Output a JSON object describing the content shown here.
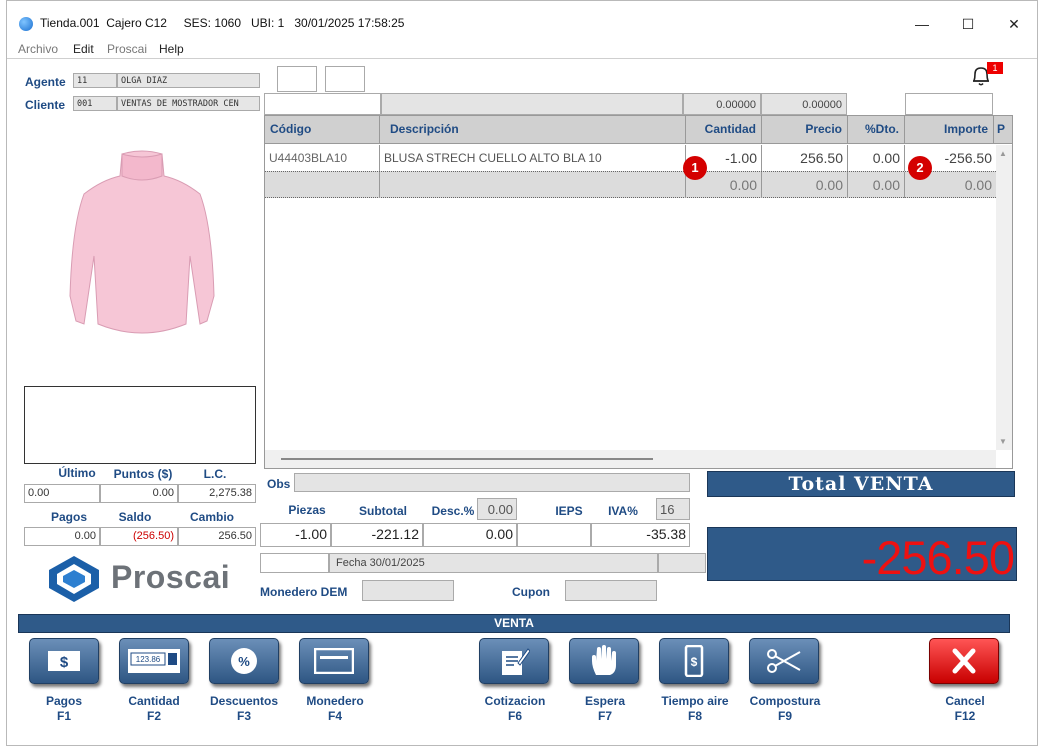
{
  "window": {
    "title": "Tienda.001  Cajero C12     SES: 1060   UBI: 1   30/01/2025 17:58:25",
    "minimize": "—",
    "maximize": "☐",
    "close": "✕"
  },
  "menu": [
    "Archivo",
    "Edit",
    "Proscai",
    "Help"
  ],
  "agente": {
    "label": "Agente",
    "code": "11",
    "name": "OLGA DIAZ"
  },
  "cliente": {
    "label": "Cliente",
    "code": "001",
    "name": "VENTAS DE MOSTRADOR CEN"
  },
  "notification": {
    "count": "1"
  },
  "header_values": {
    "v1": "0.00000",
    "v2": "0.00000"
  },
  "grid": {
    "columns": [
      "Código",
      "Descripción",
      "Cantidad",
      "Precio",
      "%Dto.",
      "Importe",
      "P"
    ],
    "rows": [
      [
        "U44403BLA10",
        "BLUSA STRECH CUELLO ALTO BLA 10",
        "-1.00",
        "256.50",
        "0.00",
        "-256.50"
      ],
      [
        "",
        "",
        "0.00",
        "0.00",
        "0.00",
        "0.00"
      ]
    ],
    "badges": [
      "1",
      "2"
    ]
  },
  "points": {
    "labels": [
      "Último",
      "Puntos ($)",
      "L.C."
    ],
    "values": [
      "0.00",
      "0.00",
      "2,275.38"
    ]
  },
  "payments": {
    "labels": [
      "Pagos",
      "Saldo",
      "Cambio"
    ],
    "values": [
      "0.00",
      "(256.50)",
      "256.50"
    ],
    "saldo_color": "#cc0000"
  },
  "brand": {
    "name": "Proscai"
  },
  "obs": {
    "label": "Obs"
  },
  "summary": {
    "labels": [
      "Piezas",
      "Subtotal",
      "Desc.%",
      "IEPS",
      "IVA%"
    ],
    "desc_pct": "0.00",
    "iva_pct": "16",
    "values": [
      "-1.00",
      "-221.12",
      "0.00",
      "",
      "-35.38"
    ]
  },
  "fecha": "Fecha 30/01/2025",
  "monedero": {
    "label": "Monedero DEM"
  },
  "cupon": {
    "label": "Cupon"
  },
  "total": {
    "label": "Total VENTA",
    "value": "-256.50",
    "value_color": "#ee1111",
    "panel_color": "#2f5a89"
  },
  "mode_bar": "VENTA",
  "fkeys": [
    {
      "name": "Pagos",
      "key": "F1",
      "icon": "dollar-bill-icon"
    },
    {
      "name": "Cantidad",
      "key": "F2",
      "icon": "calculator-icon"
    },
    {
      "name": "Descuentos",
      "key": "F3",
      "icon": "percent-icon"
    },
    {
      "name": "Monedero",
      "key": "F4",
      "icon": "card-icon"
    },
    {
      "name": "Cotizacion",
      "key": "F6",
      "icon": "document-edit-icon"
    },
    {
      "name": "Espera",
      "key": "F7",
      "icon": "hand-icon"
    },
    {
      "name": "Tiempo aire",
      "key": "F8",
      "icon": "phone-dollar-icon"
    },
    {
      "name": "Compostura",
      "key": "F9",
      "icon": "scissors-icon"
    },
    {
      "name": "Cancel",
      "key": "F12",
      "icon": "cancel-x-icon"
    }
  ],
  "calc_display": "123.86"
}
